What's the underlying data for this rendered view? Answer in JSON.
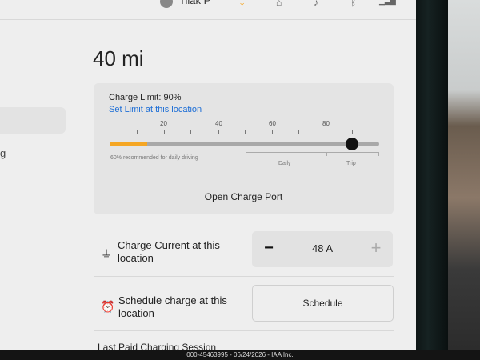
{
  "status_bar": {
    "user_name": "Tilak P",
    "icons": [
      "user-avatar",
      "download-icon",
      "seat-icon",
      "bell-icon",
      "bluetooth-icon",
      "lte-signal-icon"
    ]
  },
  "range": {
    "value": "40 mi"
  },
  "charge_limit": {
    "label": "Charge Limit: 90%",
    "percent": 90,
    "set_limit_link": "Set Limit at this location",
    "tick_labels": [
      "20",
      "40",
      "60",
      "80"
    ],
    "current_fill_percent": 14,
    "recommendation": "60% recommended for daily driving",
    "daily_label": "Daily",
    "trip_label": "Trip",
    "colors": {
      "fill": "#f5a623",
      "track": "#a8a8a8",
      "link": "#1d6ed6"
    }
  },
  "open_charge_port": {
    "label": "Open Charge Port"
  },
  "charge_current": {
    "label": "Charge Current at this location",
    "value": "48 A",
    "minus": "−",
    "plus": "+"
  },
  "schedule": {
    "label": "Schedule charge at this location",
    "button": "Schedule"
  },
  "last_paid": {
    "label": "Last Paid Charging Session"
  },
  "left_panel": {
    "partial_text": "g"
  },
  "watermark": {
    "text": "000-45463995 - 06/24/2026 - IAA Inc."
  }
}
